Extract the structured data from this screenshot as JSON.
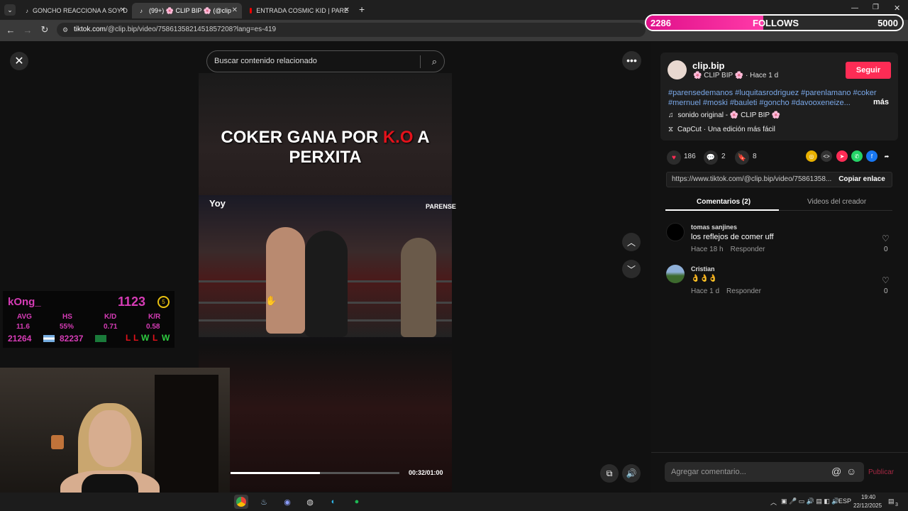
{
  "browser": {
    "tabs": [
      {
        "title": "GONCHO REACCIONA A SOY D",
        "icon": "tiktok-icon",
        "active": false
      },
      {
        "title": "(99+) 🌸 CLIP BIP 🌸 (@clip",
        "icon": "tiktok-icon",
        "active": true
      },
      {
        "title": "ENTRADA COSMIC KID | PARE",
        "icon": "youtube-icon",
        "active": false
      }
    ],
    "new_tab": "+",
    "url_host": "tiktok.com",
    "url_path": "/@clip.bip/video/7586135821451857208?lang=es-419"
  },
  "follows_widget": {
    "current": "2286",
    "label": "FOLLOWS",
    "goal": "5000",
    "progress": 0.457
  },
  "tiktok": {
    "search_placeholder": "Buscar contenido relacionado",
    "video": {
      "caption_before": "COKER GANA POR ",
      "caption_highlight": "K.O",
      "caption_after": " A PERXITA",
      "watermark_left": "Yoy",
      "watermark_right": "PARENSE",
      "time": "00:32/01:00",
      "progress": 0.53
    },
    "author": {
      "username": "clip.bip",
      "nickname": "🌸 CLIP BIP 🌸",
      "time": "· Hace 1 d",
      "follow_label": "Seguir"
    },
    "description": "#parensedemanos #luquitasrodriguez #parenlamano #coker #mernuel #moski #bauleti #goncho #davooxeneize...",
    "more_label": "más",
    "sound": "sonido original - 🌸 CLIP BIP 🌸",
    "capcut": "CapCut · Una edición más fácil",
    "likes": "186",
    "comments_count": "2",
    "saves": "8",
    "link": "https://www.tiktok.com/@clip.bip/video/75861358...",
    "copy_label": "Copiar enlace",
    "tab_comments": "Comentarios (2)",
    "tab_creator": "Videos del creador",
    "comments": [
      {
        "user": "tomas sanjines",
        "text": "los reflejos de comer uff",
        "time": "Hace 18 h",
        "reply": "Responder",
        "likes": "0"
      },
      {
        "user": "Cristian",
        "text": "👌👌👌",
        "time": "Hace 1 d",
        "reply": "Responder",
        "likes": "0"
      }
    ],
    "comment_placeholder": "Agregar comentario...",
    "publish_label": "Publicar"
  },
  "stats": {
    "name": "kOng_",
    "rank": "1123",
    "rank_level": "5",
    "headers": [
      "AVG",
      "HS",
      "K/D",
      "K/R"
    ],
    "values": [
      "11.6",
      "55%",
      "0.71",
      "0.58"
    ],
    "elo_a": "21264",
    "elo_b": "82237",
    "results": [
      "L",
      "L",
      "W",
      "L",
      "W"
    ],
    "colors": {
      "accent": "#d63cb6",
      "win": "#2ecc40",
      "loss": "#e3121b"
    }
  },
  "taskbar": {
    "lang": "ESP",
    "time": "19:40",
    "date": "22/12/2025",
    "notifications": "3"
  }
}
